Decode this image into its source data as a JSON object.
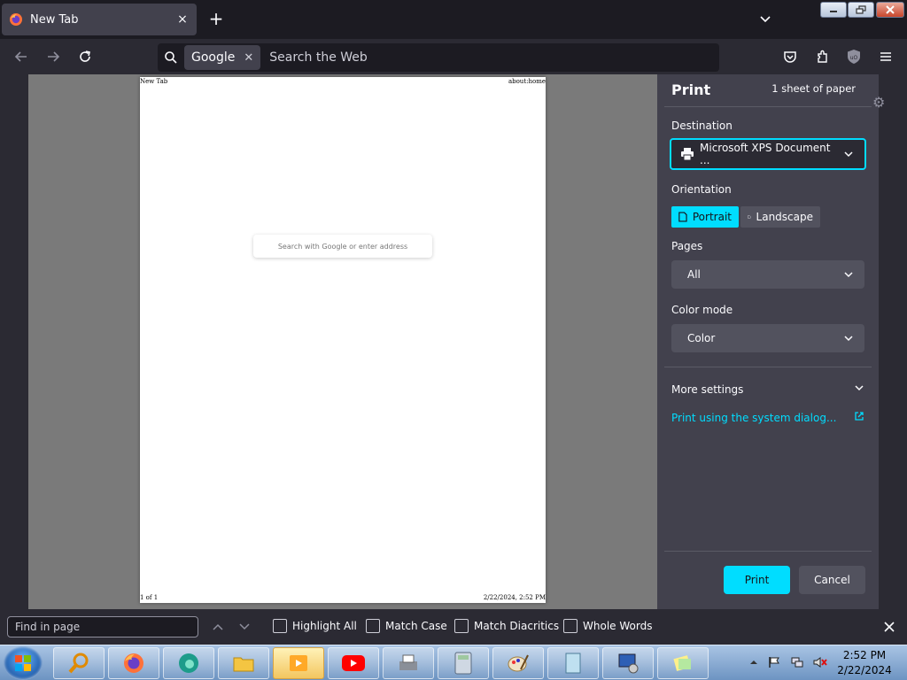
{
  "browser": {
    "tab_title": "New Tab",
    "tab_close": "×",
    "new_tab": "+",
    "search_engine": "Google",
    "search_placeholder": "Search the Web"
  },
  "preview": {
    "header_left": "New Tab",
    "header_right": "about:home",
    "footer_left": "1 of 1",
    "footer_right": "2/22/2024, 2:52 PM",
    "search_placeholder": "Search with Google or enter address"
  },
  "print_panel": {
    "title": "Print",
    "sheets": "1 sheet of paper",
    "destination_label": "Destination",
    "destination_value": "Microsoft XPS Document ...",
    "orientation_label": "Orientation",
    "portrait": "Portrait",
    "landscape": "Landscape",
    "pages_label": "Pages",
    "pages_value": "All",
    "color_mode_label": "Color mode",
    "color_mode_value": "Color",
    "more_settings": "More settings",
    "system_dialog": "Print using the system dialog...",
    "print_button": "Print",
    "cancel_button": "Cancel"
  },
  "find_bar": {
    "placeholder": "Find in page",
    "highlight_all": "Highlight All",
    "match_case": "Match Case",
    "match_diacritics": "Match Diacritics",
    "whole_words": "Whole Words"
  },
  "taskbar": {
    "time": "2:52 PM",
    "date": "2/22/2024"
  },
  "colors": {
    "accent": "#00ddff",
    "panel_bg": "#42414d",
    "toolbar_bg": "#2b2a33"
  }
}
